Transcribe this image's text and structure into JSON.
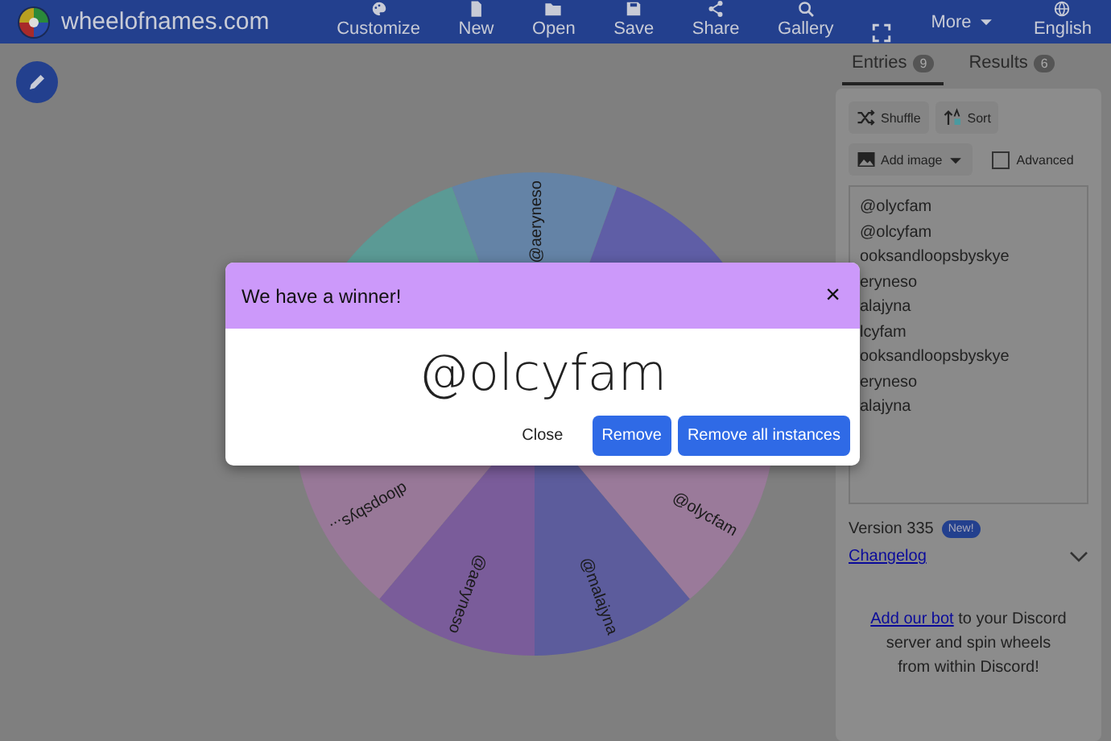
{
  "topbar": {
    "site": "wheelofnames.com",
    "nav": [
      {
        "label": "Customize",
        "kind": "button"
      },
      {
        "label": "New",
        "kind": "button"
      },
      {
        "label": "Open",
        "kind": "button"
      },
      {
        "label": "Save",
        "kind": "button"
      },
      {
        "label": "Share",
        "kind": "button"
      },
      {
        "label": "Gallery",
        "kind": "button"
      },
      {
        "kind": "fullscreen"
      },
      {
        "label": "More",
        "kind": "menu"
      },
      {
        "label": "English",
        "kind": "button"
      }
    ]
  },
  "wheel": {
    "segments": [
      {
        "label": "@aeryneso",
        "color": "#6483a6"
      },
      {
        "color": "#5f5ea6"
      },
      {
        "label": "@olycfam",
        "color": "#9a7a9a"
      },
      {
        "label": "@malajyna",
        "color": "#5c5c9c"
      },
      {
        "label": "@aeryneso",
        "color": "#7a5c9a"
      },
      {
        "label": "dloopsbys...",
        "color": "#987898"
      },
      {
        "color": "#5b9a95"
      }
    ]
  },
  "sidebar": {
    "tabs": [
      {
        "label": "Entries",
        "count": "9",
        "selected": true
      },
      {
        "label": "Results",
        "count": "6",
        "selected": false
      }
    ],
    "buttons": [
      {
        "label": "Shuffle",
        "kind": "plain"
      },
      {
        "label": "Sort",
        "kind": "plain"
      },
      {
        "label": "Add image",
        "kind": "dropdown"
      }
    ],
    "advanced": {
      "label": "Advanced",
      "checked": false
    },
    "entries": [
      "@olycfam",
      "@olcyfam",
      "ooksandloopsbyskye",
      "eryneso",
      "alajyna",
      "lcyfam",
      "ooksandloopsbyskye",
      "eryneso",
      "alajyna"
    ],
    "version": "Version 335",
    "badge": "New!",
    "changelog": "Changelog",
    "discord_link": "Add our bot",
    "discord_text": " to your Discord server and spin wheels from within Discord!"
  },
  "dialog": {
    "title": "We have a winner!",
    "close_icon": "×",
    "winner": "@olcyfam",
    "buttons": [
      {
        "label": "Close",
        "kind": "text"
      },
      {
        "label": "Remove",
        "kind": "primary"
      },
      {
        "label": "Remove all instances",
        "kind": "primary"
      }
    ]
  }
}
